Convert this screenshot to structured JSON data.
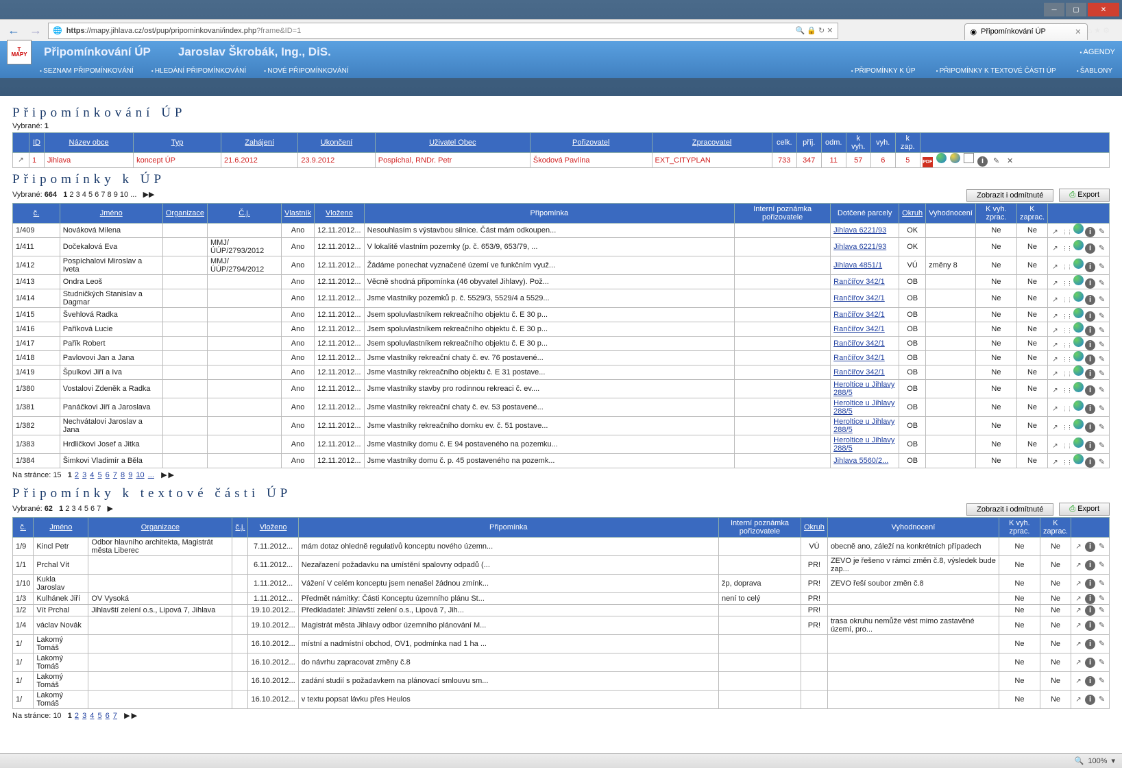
{
  "browser": {
    "url_host": "mapy.jihlava.cz",
    "url_path": "/ost/pup/pripominkovani/index.php",
    "url_query": "?frame&ID=1",
    "tab_title": "Připomínkování ÚP"
  },
  "header": {
    "app_title": "Připomínkování ÚP",
    "user": "Jaroslav Škrobák, Ing., DiS.",
    "agendy": "AGENDY",
    "menu_left": [
      "SEZNAM PŘIPOMÍNKOVÁNÍ",
      "HLEDÁNÍ PŘIPOMÍNKOVÁNÍ",
      "NOVÉ PŘIPOMÍNKOVÁNÍ"
    ],
    "menu_right": [
      "PŘIPOMÍNKY K ÚP",
      "PŘIPOMÍNKY K TEXTOVÉ ČÁSTI ÚP",
      "ŠABLONY"
    ]
  },
  "sec1": {
    "title": "Připomínkování ÚP",
    "selected_label": "Vybrané:",
    "selected_count": "1",
    "cols": [
      "ID",
      "Název obce",
      "Typ",
      "Zahájení",
      "Ukončení",
      "Uživatel Obec",
      "Pořizovatel",
      "Zpracovatel",
      "celk.",
      "příj.",
      "odm.",
      "k vyh.",
      "vyh.",
      "k zap."
    ],
    "row": {
      "id": "1",
      "obec": "Jihlava",
      "typ": "koncept ÚP",
      "zah": "21.6.2012",
      "uko": "23.9.2012",
      "uziv": "Pospíchal, RNDr. Petr",
      "por": "Škodová Pavlína",
      "zpr": "EXT_CITYPLAN",
      "celk": "733",
      "prij": "347",
      "odm": "11",
      "kvyh": "57",
      "vyh": "6",
      "kzap": "5"
    }
  },
  "sec2": {
    "title": "Připomínky k ÚP",
    "selected_label": "Vybrané:",
    "selected_count": "664",
    "pages": [
      "1",
      "2",
      "3",
      "4",
      "5",
      "6",
      "7",
      "8",
      "9",
      "10",
      "..."
    ],
    "btn_rejected": "Zobrazit i odmítnuté",
    "btn_export": "Export",
    "cols": [
      "č.",
      "Jméno",
      "Organizace",
      "Č.j.",
      "Vlastník",
      "Vloženo",
      "Připomínka",
      "Interní poznámka pořizovatele",
      "Dotčené parcely",
      "Okruh",
      "Vyhodnocení",
      "K vyh. zprac.",
      "K zaprac."
    ],
    "na_strance_label": "Na stránce:",
    "na_strance": "15",
    "rows": [
      {
        "c": "1/409",
        "jmeno": "Nováková Milena",
        "org": "",
        "cj": "",
        "vlast": "Ano",
        "vlo": "12.11.2012...",
        "prip": "Nesouhlasím s výstavbou silnice. Část mám odkoupen...",
        "pozn": "",
        "parc": "Jihlava 6221/93",
        "okr": "OK",
        "vyh": "",
        "kvz": "Ne",
        "kz": "Ne"
      },
      {
        "c": "1/411",
        "jmeno": "Dočekalová Eva",
        "org": "",
        "cj": "MMJ/ÚÚP/2793/2012",
        "vlast": "Ano",
        "vlo": "12.11.2012...",
        "prip": "V lokalitě vlastním pozemky (p. č. 653/9, 653/79, ...",
        "pozn": "",
        "parc": "Jihlava 6221/93",
        "okr": "OK",
        "vyh": "",
        "kvz": "Ne",
        "kz": "Ne"
      },
      {
        "c": "1/412",
        "jmeno": "Pospíchalovi Miroslav a Iveta",
        "org": "",
        "cj": "MMJ/ÚÚP/2794/2012",
        "vlast": "Ano",
        "vlo": "12.11.2012...",
        "prip": "Žádáme ponechat vyznačené území ve funkčním využ...",
        "pozn": "",
        "parc": "Jihlava 4851/1",
        "okr": "VÚ",
        "vyh": "změny 8",
        "kvz": "Ne",
        "kz": "Ne"
      },
      {
        "c": "1/413",
        "jmeno": "Ondra Leoš",
        "org": "",
        "cj": "",
        "vlast": "Ano",
        "vlo": "12.11.2012...",
        "prip": "Věcně shodná připomínka (46 obyvatel Jihlavy). Pož...",
        "pozn": "",
        "parc": "Rančířov 342/1",
        "okr": "OB",
        "vyh": "",
        "kvz": "Ne",
        "kz": "Ne"
      },
      {
        "c": "1/414",
        "jmeno": "Studničkých Stanislav a Dagmar",
        "org": "",
        "cj": "",
        "vlast": "Ano",
        "vlo": "12.11.2012...",
        "prip": "Jsme vlastníky pozemků p. č. 5529/3, 5529/4 a 5529...",
        "pozn": "",
        "parc": "Rančířov 342/1",
        "okr": "OB",
        "vyh": "",
        "kvz": "Ne",
        "kz": "Ne"
      },
      {
        "c": "1/415",
        "jmeno": "Švehlová Radka",
        "org": "",
        "cj": "",
        "vlast": "Ano",
        "vlo": "12.11.2012...",
        "prip": "Jsem spoluvlastníkem rekreačního objektu č. E 30 p...",
        "pozn": "",
        "parc": "Rančířov 342/1",
        "okr": "OB",
        "vyh": "",
        "kvz": "Ne",
        "kz": "Ne"
      },
      {
        "c": "1/416",
        "jmeno": "Paříková Lucie",
        "org": "",
        "cj": "",
        "vlast": "Ano",
        "vlo": "12.11.2012...",
        "prip": "Jsem spoluvlastníkem rekreačního objektu č. E 30 p...",
        "pozn": "",
        "parc": "Rančířov 342/1",
        "okr": "OB",
        "vyh": "",
        "kvz": "Ne",
        "kz": "Ne"
      },
      {
        "c": "1/417",
        "jmeno": "Pařík Robert",
        "org": "",
        "cj": "",
        "vlast": "Ano",
        "vlo": "12.11.2012...",
        "prip": "Jsem spoluvlastníkem rekreačního objektu č. E 30 p...",
        "pozn": "",
        "parc": "Rančířov 342/1",
        "okr": "OB",
        "vyh": "",
        "kvz": "Ne",
        "kz": "Ne"
      },
      {
        "c": "1/418",
        "jmeno": "Pavlovovi Jan a Jana",
        "org": "",
        "cj": "",
        "vlast": "Ano",
        "vlo": "12.11.2012...",
        "prip": "Jsme vlastníky rekreační chaty č. ev. 76 postavené...",
        "pozn": "",
        "parc": "Rančířov 342/1",
        "okr": "OB",
        "vyh": "",
        "kvz": "Ne",
        "kz": "Ne"
      },
      {
        "c": "1/419",
        "jmeno": "Špulkovi Jiří a Iva",
        "org": "",
        "cj": "",
        "vlast": "Ano",
        "vlo": "12.11.2012...",
        "prip": "Jsme vlastníky rekreačního objektu č. E 31 postave...",
        "pozn": "",
        "parc": "Rančířov 342/1",
        "okr": "OB",
        "vyh": "",
        "kvz": "Ne",
        "kz": "Ne"
      },
      {
        "c": "1/380",
        "jmeno": "Vostalovi Zdeněk a Radka",
        "org": "",
        "cj": "",
        "vlast": "Ano",
        "vlo": "12.11.2012...",
        "prip": "Jsme vlastníky stavby pro rodinnou rekreaci č. ev....",
        "pozn": "",
        "parc": "Heroltice u Jihlavy 288/5",
        "okr": "OB",
        "vyh": "",
        "kvz": "Ne",
        "kz": "Ne"
      },
      {
        "c": "1/381",
        "jmeno": "Panáčkovi Jiří a Jaroslava",
        "org": "",
        "cj": "",
        "vlast": "Ano",
        "vlo": "12.11.2012...",
        "prip": "Jsme vlastníky rekreační chaty č. ev. 53 postavené...",
        "pozn": "",
        "parc": "Heroltice u Jihlavy 288/5",
        "okr": "OB",
        "vyh": "",
        "kvz": "Ne",
        "kz": "Ne"
      },
      {
        "c": "1/382",
        "jmeno": "Nechvátalovi Jaroslav a Jana",
        "org": "",
        "cj": "",
        "vlast": "Ano",
        "vlo": "12.11.2012...",
        "prip": "Jsme vlastníky rekreačního domku ev. č. 51 postave...",
        "pozn": "",
        "parc": "Heroltice u Jihlavy 288/5",
        "okr": "OB",
        "vyh": "",
        "kvz": "Ne",
        "kz": "Ne"
      },
      {
        "c": "1/383",
        "jmeno": "Hrdličkovi Josef a Jitka",
        "org": "",
        "cj": "",
        "vlast": "Ano",
        "vlo": "12.11.2012...",
        "prip": "Jsme vlastníky domu č. E 94 postaveného na pozemku...",
        "pozn": "",
        "parc": "Heroltice u Jihlavy 288/5",
        "okr": "OB",
        "vyh": "",
        "kvz": "Ne",
        "kz": "Ne"
      },
      {
        "c": "1/384",
        "jmeno": "Šimkovi Vladimír a Běla",
        "org": "",
        "cj": "",
        "vlast": "Ano",
        "vlo": "12.11.2012...",
        "prip": "Jsme vlastníky domu č. p. 45 postaveného na pozemk...",
        "pozn": "",
        "parc": "Jihlava 5560/2...",
        "okr": "OB",
        "vyh": "",
        "kvz": "Ne",
        "kz": "Ne"
      }
    ]
  },
  "sec3": {
    "title": "Připomínky k textové části ÚP",
    "selected_label": "Vybrané:",
    "selected_count": "62",
    "pages": [
      "1",
      "2",
      "3",
      "4",
      "5",
      "6",
      "7"
    ],
    "btn_rejected": "Zobrazit i odmítnuté",
    "btn_export": "Export",
    "cols": [
      "č.",
      "Jméno",
      "Organizace",
      "č.j.",
      "Vloženo",
      "Připomínka",
      "Interní poznámka pořizovatele",
      "Okruh",
      "Vyhodnocení",
      "K vyh. zprac.",
      "K zaprac."
    ],
    "na_strance_label": "Na stránce:",
    "na_strance": "10",
    "rows": [
      {
        "c": "1/9",
        "jmeno": "Kincl  Petr",
        "org": "Odbor hlavního architekta, Magistrát města Liberec",
        "cj": "",
        "vlo": "7.11.2012...",
        "prip": "mám dotaz ohledně regulativů konceptu nového územn...",
        "pozn": "",
        "okr": "VÚ",
        "vyh": "obecně ano, záleží na konkrétních případech",
        "kvz": "Ne",
        "kz": "Ne"
      },
      {
        "c": "1/1",
        "jmeno": "Prchal Vít",
        "org": "",
        "cj": "",
        "vlo": "6.11.2012...",
        "prip": "Nezařazení požadavku na umístění spalovny odpadů (...",
        "pozn": "",
        "okr": "PR!",
        "vyh": "ZEVO je řešeno v rámci změn č.8, výsledek bude zap...",
        "kvz": "Ne",
        "kz": "Ne"
      },
      {
        "c": "1/10",
        "jmeno": "Kukla Jaroslav",
        "org": "",
        "cj": "",
        "vlo": "1.11.2012...",
        "prip": "Vážení V celém konceptu jsem nenašel žádnou zmínk...",
        "pozn": "žp, doprava",
        "okr": "PR!",
        "vyh": "ZEVO řeší soubor změn č.8",
        "kvz": "Ne",
        "kz": "Ne"
      },
      {
        "c": "1/3",
        "jmeno": "Kulhánek Jiří",
        "org": "OV Vysoká",
        "cj": "",
        "vlo": "1.11.2012...",
        "prip": "Předmět námitky: Části Konceptu územního plánu St...",
        "pozn": "není to celý",
        "okr": "PR!",
        "vyh": "",
        "kvz": "Ne",
        "kz": "Ne"
      },
      {
        "c": "1/2",
        "jmeno": "Vít Prchal",
        "org": "Jihlavští zelení o.s., Lipová 7, Jihlava",
        "cj": "",
        "vlo": "19.10.2012...",
        "prip": "Předkladatel: Jihlavští zelení o.s., Lipová 7, Jih...",
        "pozn": "",
        "okr": "PR!",
        "vyh": "",
        "kvz": "Ne",
        "kz": "Ne"
      },
      {
        "c": "1/4",
        "jmeno": "václav Novák",
        "org": "",
        "cj": "",
        "vlo": "19.10.2012...",
        "prip": "Magistrát města Jihlavy odbor územního plánování M...",
        "pozn": "",
        "okr": "PR!",
        "vyh": "trasa okruhu nemůže vést mimo zastavěné území, pro...",
        "kvz": "Ne",
        "kz": "Ne"
      },
      {
        "c": "1/",
        "jmeno": "Lakomý Tomáš",
        "org": "",
        "cj": "",
        "vlo": "16.10.2012...",
        "prip": "místní a nadmístní obchod, OV1, podmínka nad 1 ha ...",
        "pozn": "",
        "okr": "",
        "vyh": "",
        "kvz": "Ne",
        "kz": "Ne"
      },
      {
        "c": "1/",
        "jmeno": "Lakomý Tomáš",
        "org": "",
        "cj": "",
        "vlo": "16.10.2012...",
        "prip": "do návrhu zapracovat změny č.8",
        "pozn": "",
        "okr": "",
        "vyh": "",
        "kvz": "Ne",
        "kz": "Ne"
      },
      {
        "c": "1/",
        "jmeno": "Lakomý Tomáš",
        "org": "",
        "cj": "",
        "vlo": "16.10.2012...",
        "prip": "zadání studií s požadavkem na plánovací smlouvu sm...",
        "pozn": "",
        "okr": "",
        "vyh": "",
        "kvz": "Ne",
        "kz": "Ne"
      },
      {
        "c": "1/",
        "jmeno": "Lakomý Tomáš",
        "org": "",
        "cj": "",
        "vlo": "16.10.2012...",
        "prip": "v textu popsat lávku přes Heulos",
        "pozn": "",
        "okr": "",
        "vyh": "",
        "kvz": "Ne",
        "kz": "Ne"
      }
    ]
  },
  "zoom": "100%"
}
